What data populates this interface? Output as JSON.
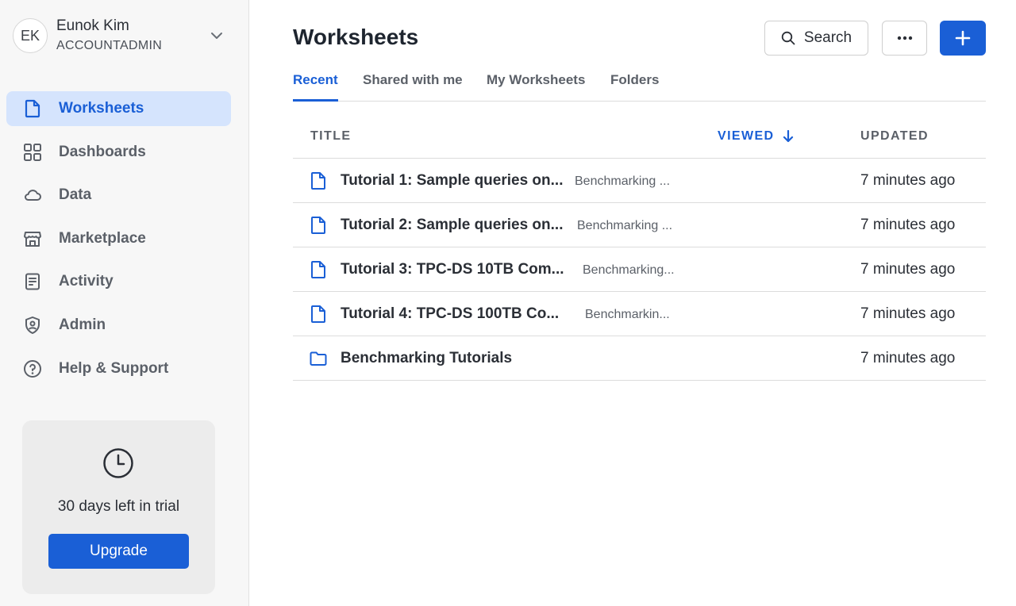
{
  "user": {
    "initials": "EK",
    "name": "Eunok Kim",
    "role": "ACCOUNTADMIN"
  },
  "nav": [
    {
      "label": "Worksheets",
      "icon": "worksheet-icon",
      "active": true
    },
    {
      "label": "Dashboards",
      "icon": "dashboard-grid-icon"
    },
    {
      "label": "Data",
      "icon": "cloud-icon"
    },
    {
      "label": "Marketplace",
      "icon": "storefront-icon"
    },
    {
      "label": "Activity",
      "icon": "activity-list-icon"
    },
    {
      "label": "Admin",
      "icon": "shield-user-icon"
    },
    {
      "label": "Help & Support",
      "icon": "help-circle-icon"
    }
  ],
  "trial": {
    "text": "30 days left in trial",
    "upgrade_label": "Upgrade"
  },
  "header": {
    "title": "Worksheets",
    "search_label": "Search"
  },
  "tabs": [
    "Recent",
    "Shared with me",
    "My Worksheets",
    "Folders"
  ],
  "table": {
    "columns": {
      "title": "TITLE",
      "viewed": "VIEWED",
      "updated": "UPDATED"
    },
    "rows": [
      {
        "type": "worksheet",
        "title": "Tutorial 1: Sample queries on...",
        "folder": "Benchmarking ...",
        "updated": "7 minutes ago"
      },
      {
        "type": "worksheet",
        "title": "Tutorial 2: Sample queries on...",
        "folder": "Benchmarking ...",
        "updated": "7 minutes ago"
      },
      {
        "type": "worksheet",
        "title": "Tutorial 3: TPC-DS 10TB Com...",
        "folder": "Benchmarking...",
        "updated": "7 minutes ago"
      },
      {
        "type": "worksheet",
        "title": "Tutorial 4: TPC-DS 100TB Co...",
        "folder": "Benchmarkin...",
        "updated": "7 minutes ago"
      },
      {
        "type": "folder",
        "title": "Benchmarking Tutorials",
        "folder": "",
        "updated": "7 minutes ago"
      }
    ]
  },
  "colors": {
    "accent": "#1a5fd6",
    "active_nav_bg": "#d5e4fd",
    "sidebar_bg": "#f7f7f7"
  }
}
